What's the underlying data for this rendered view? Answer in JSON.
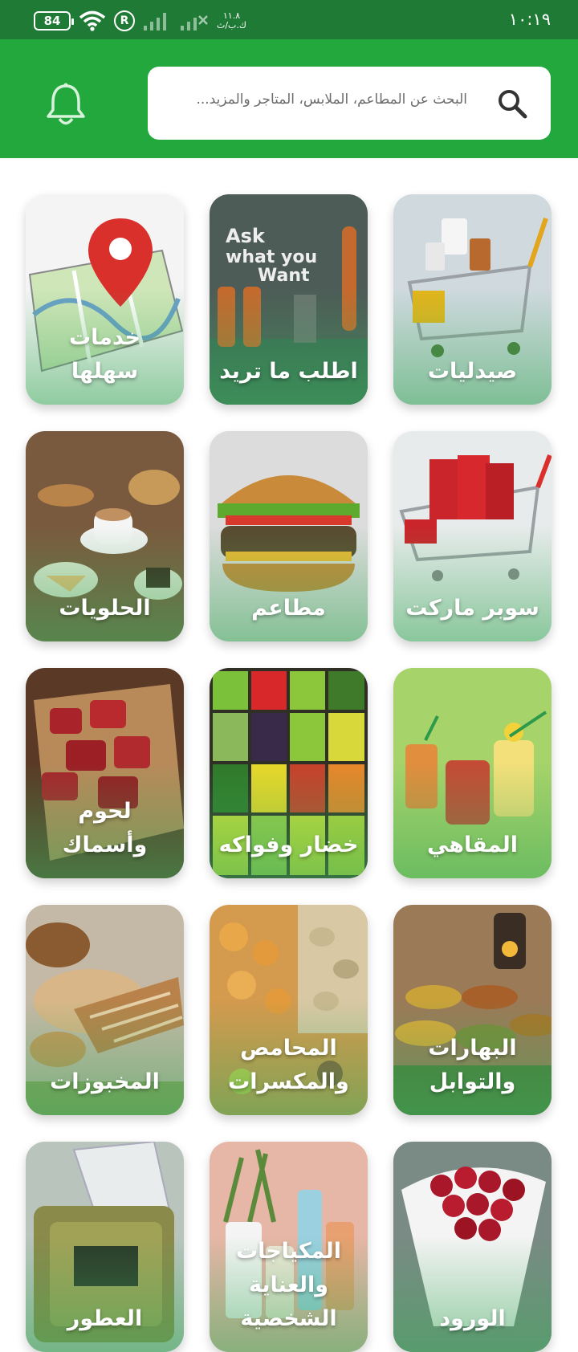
{
  "status_bar": {
    "time": "١٠:١٩",
    "battery": "84",
    "roaming": "R",
    "net_speed_value": "١١.٨",
    "net_speed_unit": "ك.ب/ث"
  },
  "header": {
    "search_placeholder": "البحث عن المطاعم، الملابس، المتاجر والمزيد...",
    "search_icon": "search-icon",
    "notification_icon": "bell-icon"
  },
  "categories": [
    {
      "label": "صيدليات",
      "icon": "pharmacy-cart",
      "bg": "#c9d6dc"
    },
    {
      "label": "اطلب ما تريد",
      "icon": "ask-what-you-want",
      "bg": "#4b5a55"
    },
    {
      "label": "خدمات سهلها",
      "icon": "map-pin",
      "bg": "#f4f4f4"
    },
    {
      "label": "سوبر ماركت",
      "icon": "shopping-cart-bags",
      "bg": "#e6eaea"
    },
    {
      "label": "مطاعم",
      "icon": "burger",
      "bg": "#dcdcdc"
    },
    {
      "label": "الحلويات",
      "icon": "coffee-pastries",
      "bg": "#7a5a3e"
    },
    {
      "label": "المقاهي",
      "icon": "juice-glasses",
      "bg": "#a6d36a"
    },
    {
      "label": "خضار وفواكه",
      "icon": "vegetable-crates",
      "bg": "#3b3b2e"
    },
    {
      "label": "لحوم وأسماك",
      "icon": "meat-board",
      "bg": "#6b4630"
    },
    {
      "label": "البهارات والتوابل",
      "icon": "spice-bowls",
      "bg": "#9b7a58"
    },
    {
      "label": "المحامص والمكسرات",
      "icon": "nuts",
      "bg": "#c98a44"
    },
    {
      "label": "المخبوزات",
      "icon": "bread",
      "bg": "#b8a58b"
    },
    {
      "label": "الورود",
      "icon": "rose-bouquet",
      "bg": "#7a8a84"
    },
    {
      "label": "المكياجات والعناية الشخصية",
      "icon": "cosmetics",
      "bg": "#e8b8a8"
    },
    {
      "label": "العطور",
      "icon": "perfume-bottle",
      "bg": "#b8c4bc"
    }
  ]
}
